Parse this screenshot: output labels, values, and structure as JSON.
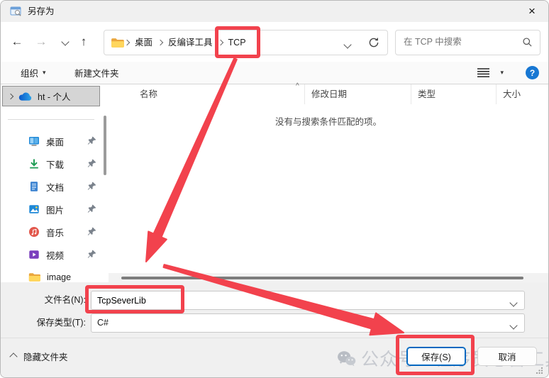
{
  "colors": {
    "annotation_red": "#f2424d",
    "accent_blue": "#0067c0",
    "help_blue": "#1777d3",
    "onedrive_blue": "#0f6cbd",
    "chrome_gray": "#f0f0f0"
  },
  "icons": {
    "back": "←",
    "forward": "→",
    "up": "↑",
    "close": "×",
    "caret_down": "▾",
    "sort_caret": "^",
    "help": "?"
  },
  "title_bar": {
    "title": "另存为"
  },
  "navigation": {
    "breadcrumb": {
      "items": [
        "桌面",
        "反编译工具",
        "TCP"
      ]
    },
    "search": {
      "placeholder": "在 TCP 中搜索"
    }
  },
  "toolbar": {
    "organize_label": "组织",
    "new_folder_label": "新建文件夹"
  },
  "sidebar": {
    "onedrive_label": "ht - 个人",
    "items": [
      {
        "label": "桌面",
        "icon": "desktop-icon",
        "pinned": true
      },
      {
        "label": "下载",
        "icon": "downloads-icon",
        "pinned": true
      },
      {
        "label": "文档",
        "icon": "documents-icon",
        "pinned": true
      },
      {
        "label": "图片",
        "icon": "pictures-icon",
        "pinned": true
      },
      {
        "label": "音乐",
        "icon": "music-icon",
        "pinned": true
      },
      {
        "label": "视频",
        "icon": "videos-icon",
        "pinned": true
      },
      {
        "label": "image",
        "icon": "folder-icon",
        "pinned": false
      }
    ]
  },
  "file_list": {
    "columns": [
      "名称",
      "修改日期",
      "类型",
      "大小"
    ],
    "empty_message": "没有与搜索条件匹配的项。"
  },
  "form": {
    "file_name_label": "文件名(N):",
    "file_name_value": "TcpSeverLib",
    "save_type_label": "保存类型(T):",
    "save_type_value": "C#"
  },
  "footer": {
    "hide_folders_label": "隐藏文件夹",
    "save_label": "保存(S)",
    "cancel_label": "取消",
    "watermark_text": "公众号 · 程序员必备工具"
  }
}
